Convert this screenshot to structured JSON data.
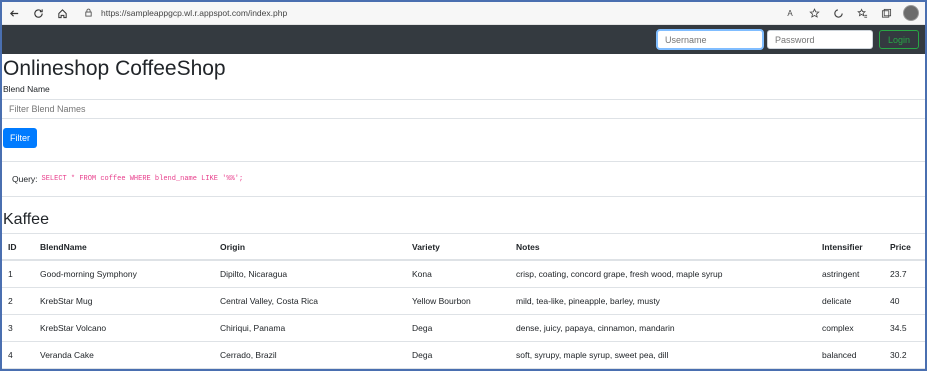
{
  "browser": {
    "url": "https://sampleappgcp.wl.r.appspot.com/index.php",
    "read_aloud_icon_label": "A"
  },
  "navbar": {
    "username_placeholder": "Username",
    "password_placeholder": "Password",
    "login_label": "Login"
  },
  "page": {
    "title": "Onlineshop CoffeeShop",
    "blend_label": "Blend Name",
    "filter_placeholder": "Filter Blend Names",
    "filter_button": "Filter",
    "query_label": "Query:",
    "query_text": "SELECT * FROM coffee WHERE blend_name LIKE '%%';"
  },
  "section": {
    "title": "Kaffee"
  },
  "table": {
    "columns": [
      "ID",
      "BlendName",
      "Origin",
      "Variety",
      "Notes",
      "Intensifier",
      "Price"
    ],
    "rows": [
      {
        "id": "1",
        "name": "Good-morning Symphony",
        "origin": "Dipilto, Nicaragua",
        "variety": "Kona",
        "notes": "crisp, coating, concord grape, fresh wood, maple syrup",
        "intensifier": "astringent",
        "price": "23.7"
      },
      {
        "id": "2",
        "name": "KrebStar Mug",
        "origin": "Central Valley, Costa Rica",
        "variety": "Yellow Bourbon",
        "notes": "mild, tea-like, pineapple, barley, musty",
        "intensifier": "delicate",
        "price": "40"
      },
      {
        "id": "3",
        "name": "KrebStar Volcano",
        "origin": "Chiriqui, Panama",
        "variety": "Dega",
        "notes": "dense, juicy, papaya, cinnamon, mandarin",
        "intensifier": "complex",
        "price": "34.5"
      },
      {
        "id": "4",
        "name": "Veranda Cake",
        "origin": "Cerrado, Brazil",
        "variety": "Dega",
        "notes": "soft, syrupy, maple syrup, sweet pea, dill",
        "intensifier": "balanced",
        "price": "30.2"
      }
    ]
  }
}
